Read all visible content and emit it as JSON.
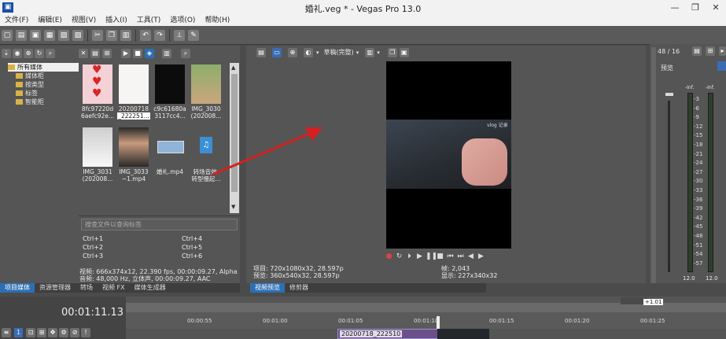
{
  "window": {
    "title": "婚礼.veg * - Vegas Pro 13.0",
    "minimize": "—",
    "maximize": "❐",
    "close": "✕"
  },
  "menu": [
    "文件(F)",
    "编辑(E)",
    "视图(V)",
    "插入(I)",
    "工具(T)",
    "选项(O)",
    "帮助(H)"
  ],
  "media_tree": {
    "items": [
      "所有媒体",
      "媒体柜",
      "按类型",
      "标签",
      "智能柜"
    ]
  },
  "media_items": [
    {
      "label1": "8fc97220d",
      "label2": "6aefc92e...",
      "thumb": "hearts"
    },
    {
      "label1": "20200718",
      "label2": "_222251...",
      "thumb": "white"
    },
    {
      "label1": "c9c61680a",
      "label2": "3117cc4...",
      "thumb": "black"
    },
    {
      "label1": "IMG_3030",
      "label2": "(202008...",
      "thumb": "photo"
    },
    {
      "label1": "IMG_3031",
      "label2": "(202008...",
      "thumb": "photo"
    },
    {
      "label1": "IMG_3033",
      "label2": "~1.mp4",
      "thumb": "face"
    },
    {
      "label1": "婚礼.mp4",
      "label2": "",
      "thumb": "video"
    },
    {
      "label1": "转场音效-",
      "label2": "转型慢起...",
      "thumb": "audio"
    }
  ],
  "search_placeholder": "搜查文件以查询标签",
  "shortcuts": [
    "Ctrl+1",
    "Ctrl+4",
    "Ctrl+2",
    "Ctrl+5",
    "Ctrl+3",
    "Ctrl+6"
  ],
  "media_info": {
    "video": "视频: 666x374x12, 22.390 fps, 00:00:09.27, Alpha =",
    "audio": "音频: 48,000 Hz, 立体声, 00:00:09.27, AAC"
  },
  "left_tabs": [
    "项目媒体",
    "资源管理器",
    "转场",
    "视频 FX",
    "媒体生成器"
  ],
  "preview": {
    "quality": "草稿(完整)",
    "project": "项目: 720x1080x32, 28.597p",
    "preview": "预览: 360x540x32, 28.597p",
    "frame": "帧: 2,043",
    "display": "显示: 227x340x32",
    "watermark": "vlog 记录",
    "tabs": [
      "视频预览",
      "修剪器"
    ]
  },
  "meters": {
    "header": "48 / 16",
    "label": "预览",
    "scale": [
      "3",
      "6",
      "9",
      "12",
      "15",
      "18",
      "21",
      "24",
      "27",
      "30",
      "33",
      "36",
      "39",
      "42",
      "45",
      "48",
      "51",
      "54",
      "57"
    ],
    "left_value": "12.0",
    "right_value": "12.0",
    "left_top": "-Inf.",
    "right_top": "-Inf."
  },
  "timeline": {
    "timecode": "00:01:11.13",
    "ruler": [
      "00:00:55",
      "00:01:00",
      "00:01:05",
      "00:01:10",
      "00:01:15",
      "00:01:20",
      "00:01:25"
    ],
    "rate": "+1.01",
    "clip": "20200718_222510",
    "track_number": "1"
  },
  "colors": {
    "accent": "#2d6fb4",
    "arrow": "#d42020"
  }
}
